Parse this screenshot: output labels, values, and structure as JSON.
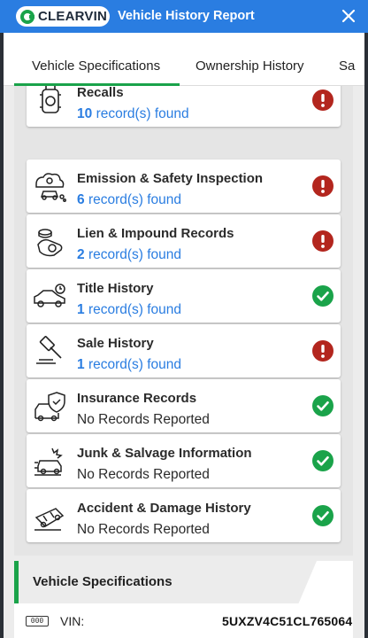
{
  "header": {
    "logo_text": "CLEARVIN",
    "title": "Vehicle History Report",
    "close_icon": "close-icon"
  },
  "tabs": [
    {
      "label": "Vehicle Specifications",
      "active": true
    },
    {
      "label": "Ownership History",
      "active": false
    },
    {
      "label": "Sa",
      "active": false
    }
  ],
  "colors": {
    "brand_blue": "#2a7de1",
    "accent_green": "#1aa34a",
    "alert_red": "#b3261e",
    "ok_green": "#1aa34a"
  },
  "records": [
    {
      "title": "Recalls",
      "count": "10",
      "suffix": "record(s) found",
      "status": "alert",
      "icon": "recall-engine-icon"
    },
    {
      "title": "Emission & Safety Inspection",
      "count": "6",
      "suffix": "record(s) found",
      "status": "alert",
      "icon": "emission-car-icon"
    },
    {
      "title": "Lien & Impound Records",
      "count": "2",
      "suffix": "record(s) found",
      "status": "alert",
      "icon": "lien-money-icon"
    },
    {
      "title": "Title History",
      "count": "1",
      "suffix": "record(s) found",
      "status": "ok",
      "icon": "title-car-icon"
    },
    {
      "title": "Sale History",
      "count": "1",
      "suffix": "record(s) found",
      "status": "alert",
      "icon": "gavel-icon"
    },
    {
      "title": "Insurance Records",
      "text": "No Records Reported",
      "status": "ok",
      "icon": "insurance-shield-icon"
    },
    {
      "title": "Junk & Salvage Information",
      "text": "No Records Reported",
      "status": "ok",
      "icon": "junk-salvage-icon"
    },
    {
      "title": "Accident & Damage History",
      "text": "No Records Reported",
      "status": "ok",
      "icon": "accident-car-icon"
    }
  ],
  "specs": {
    "title": "Vehicle Specifications",
    "vin_icon_text": "000",
    "vin_label": "VIN:",
    "vin_value": "5UXZV4C51CL765064"
  }
}
